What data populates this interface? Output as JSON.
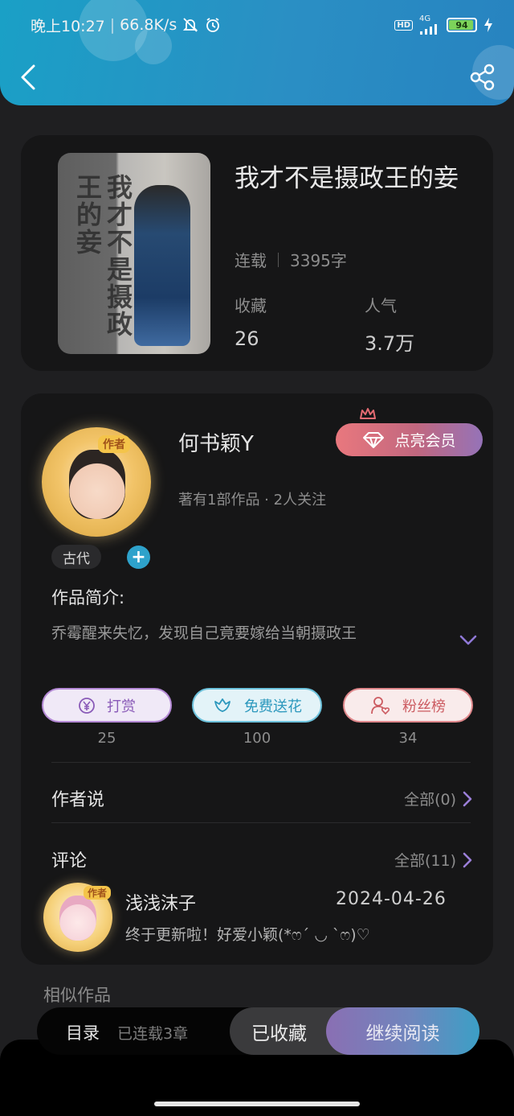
{
  "status_bar": {
    "time": "晚上10:27",
    "speed": "66.8K/s",
    "hd": "HD",
    "network": "4G",
    "battery": "94",
    "battery_level": 0.94
  },
  "book": {
    "title": "我才不是摄政王的妾",
    "status": "连载",
    "word_count": "3395字",
    "favorites_label": "收藏",
    "favorites_value": "26",
    "popularity_label": "人气",
    "popularity_value": "3.7万",
    "cover_text": "我才不是摄政王的妾"
  },
  "author": {
    "tag": "作者",
    "name": "何书颖Y",
    "vip_button": "点亮会员",
    "subtitle": "著有1部作品 · 2人关注",
    "genre_tag": "古代",
    "add_tag": "+",
    "intro_title": "作品简介:",
    "intro_text": "乔霉醒来失忆，发现自己竟要嫁给当朝摄政王"
  },
  "actions": [
    {
      "label": "打赏",
      "count": "25"
    },
    {
      "label": "免费送花",
      "count": "100"
    },
    {
      "label": "粉丝榜",
      "count": "34"
    }
  ],
  "author_says": {
    "title": "作者说",
    "link": "全部(0)"
  },
  "comments": {
    "title": "评论",
    "link": "全部(11)",
    "items": [
      {
        "tag": "作者",
        "name": "浅浅沫子",
        "date": "2024-04-26",
        "text": "终于更新啦！好爱小颖(*ෆ´ ◡ `ෆ)♡"
      }
    ]
  },
  "similar_title": "相似作品",
  "bottom_bar": {
    "toc": "目录",
    "toc_sub": "已连载3章",
    "collected": "已收藏",
    "read": "继续阅读"
  },
  "colors": {
    "header": "#1aa0c6",
    "vip": "#e9787e",
    "tip": "#8a5bb8",
    "flower": "#2c98bd",
    "fans": "#cc5c62"
  }
}
